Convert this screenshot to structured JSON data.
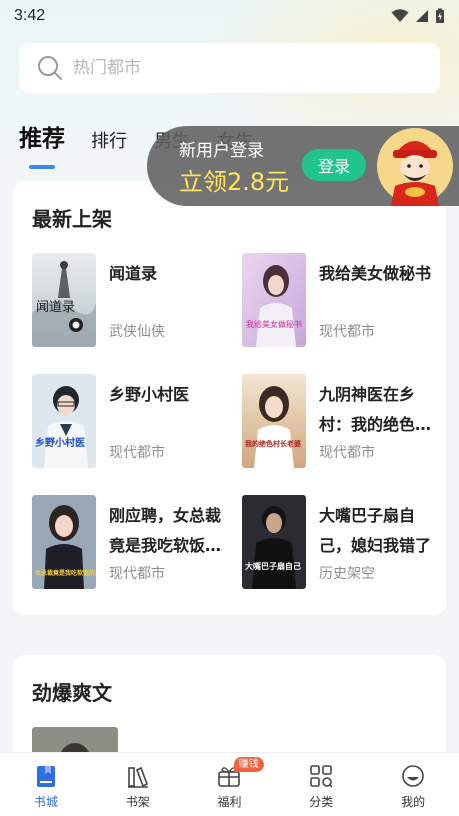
{
  "status": {
    "time": "3:42"
  },
  "search": {
    "placeholder": "热门都市"
  },
  "tabs": [
    {
      "label": "推荐",
      "active": true
    },
    {
      "label": "排行"
    },
    {
      "label": "男生"
    },
    {
      "label": "女生"
    }
  ],
  "promo": {
    "line1": "新用户登录",
    "line2": "立领2.8元",
    "button": "登录"
  },
  "sections": {
    "new": {
      "title": "最新上架",
      "books": [
        {
          "title": "闻道录",
          "genre": "武侠仙侠",
          "cover_text": "闻道录"
        },
        {
          "title": "我给美女做秘书",
          "genre": "现代都市",
          "cover_text": "我给美女做秘书"
        },
        {
          "title": "乡野小村医",
          "genre": "现代都市",
          "cover_text": "乡野小村医"
        },
        {
          "title": "九阴神医在乡村：我的绝色村长老婆",
          "genre": "现代都市",
          "cover_text": "我的绝色村长老婆"
        },
        {
          "title": "刚应聘，女总裁竟是我吃软饭的对象",
          "genre": "现代都市",
          "cover_text": "女总裁竟是我吃软饭的对象"
        },
        {
          "title": "大嘴巴子扇自己，媳妇我错了",
          "genre": "历史架空",
          "cover_text": "大嘴巴子扇自己"
        }
      ]
    },
    "hot": {
      "title": "劲爆爽文"
    }
  },
  "nav": [
    {
      "label": "书城",
      "icon": "book-icon",
      "active": true
    },
    {
      "label": "书架",
      "icon": "bookshelf-icon"
    },
    {
      "label": "福利",
      "icon": "gift-icon",
      "badge": "赚钱"
    },
    {
      "label": "分类",
      "icon": "category-icon"
    },
    {
      "label": "我的",
      "icon": "profile-icon"
    }
  ],
  "colors": {
    "accent": "#3a87f0",
    "login_button": "#22c48e",
    "promo_text": "#ffe45c",
    "badge": "#f0653f"
  }
}
